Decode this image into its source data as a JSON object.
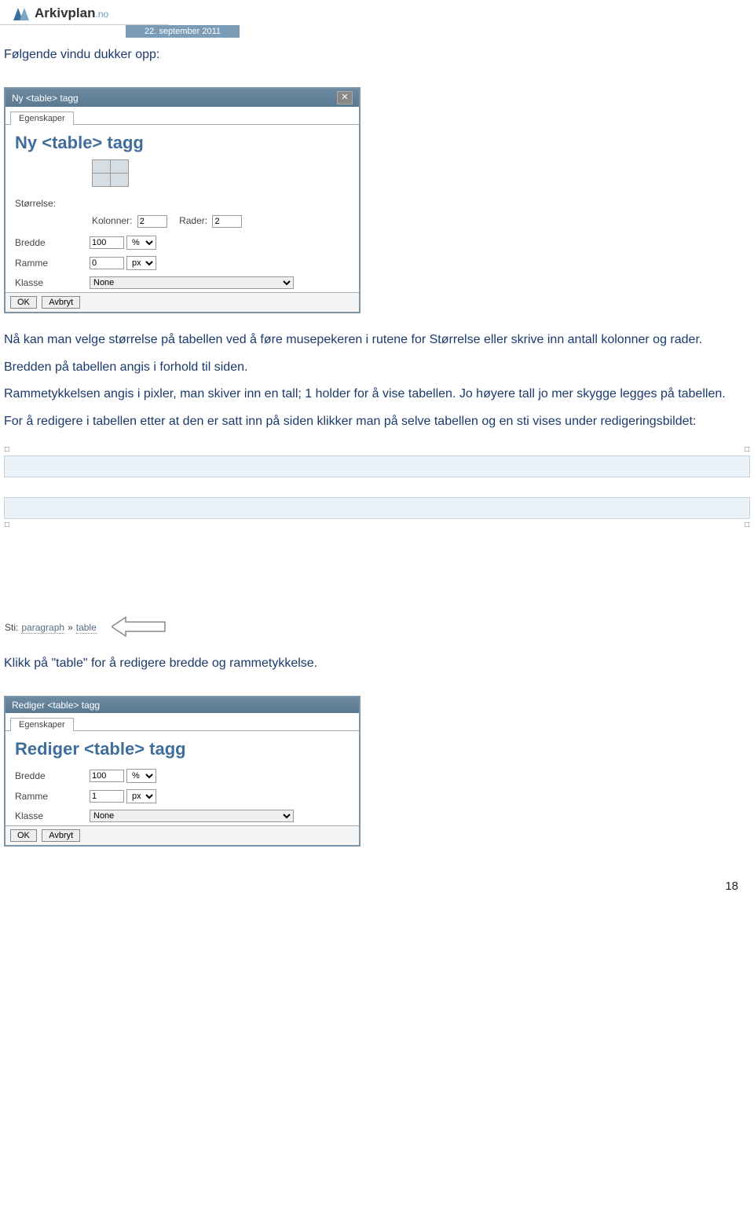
{
  "header": {
    "logo_main": "Arkivplan",
    "logo_suffix": ".no",
    "date": "22. september 2011"
  },
  "intro": {
    "p1": "Følgende vindu dukker opp:"
  },
  "dialog1": {
    "title": "Ny <table> tagg",
    "tab": "Egenskaper",
    "heading": "Ny <table> tagg",
    "storrelse_label": "Størrelse:",
    "kolonner_label": "Kolonner:",
    "kolonner_value": "2",
    "rader_label": "Rader:",
    "rader_value": "2",
    "bredde_label": "Bredde",
    "bredde_value": "100",
    "bredde_unit": "%",
    "ramme_label": "Ramme",
    "ramme_value": "0",
    "ramme_unit": "px",
    "klasse_label": "Klasse",
    "klasse_value": "None",
    "ok": "OK",
    "avbryt": "Avbryt"
  },
  "para2": "Nå kan man velge størrelse på tabellen ved å føre musepekeren i rutene for Størrelse eller skrive inn antall kolonner og rader.",
  "para3": "Bredden på tabellen angis i forhold til siden.",
  "para4": "Rammetykkelsen angis i pixler, man skiver inn en tall; 1 holder for å vise tabellen. Jo høyere tall jo mer skygge legges på tabellen.",
  "para5": "For å redigere i tabellen etter at den er satt inn på siden klikker man på selve tabellen og en sti vises under redigeringsbildet:",
  "breadcrumb": {
    "sti": "Sti:",
    "p": "paragraph",
    "sep": "»",
    "t": "table"
  },
  "para6": "Klikk på \"table\" for å redigere bredde og rammetykkelse.",
  "dialog2": {
    "title": "Rediger <table> tagg",
    "tab": "Egenskaper",
    "heading": "Rediger <table> tagg",
    "bredde_label": "Bredde",
    "bredde_value": "100",
    "bredde_unit": "%",
    "ramme_label": "Ramme",
    "ramme_value": "1",
    "ramme_unit": "px",
    "klasse_label": "Klasse",
    "klasse_value": "None",
    "ok": "OK",
    "avbryt": "Avbryt"
  },
  "page_number": "18"
}
